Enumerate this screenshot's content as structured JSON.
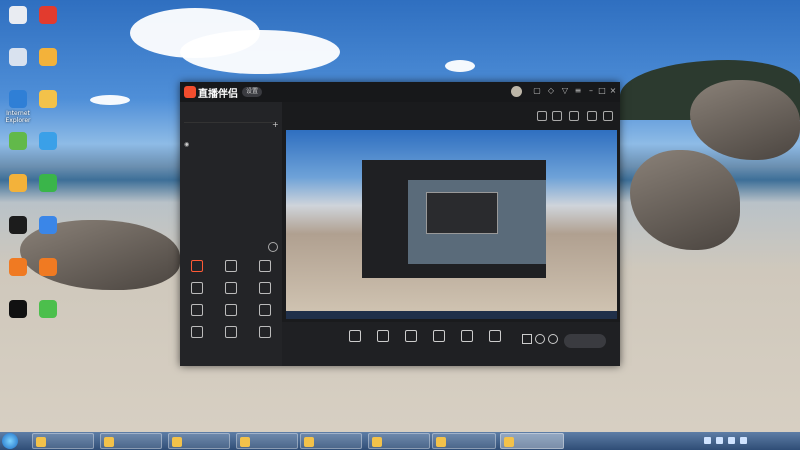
{
  "desktop_icons": [
    {
      "label": "",
      "color": "#e9ecf2"
    },
    {
      "label": "",
      "color": "#e23b2e"
    },
    {
      "label": "",
      "color": "#d9e2ef"
    },
    {
      "label": "",
      "color": "#f3b23a"
    },
    {
      "label": "Internet Explorer",
      "color": "#2f7fd6"
    },
    {
      "label": "",
      "color": "#f3c24a"
    },
    {
      "label": "",
      "color": "#62b94a"
    },
    {
      "label": "",
      "color": "#3aa0e8"
    },
    {
      "label": "",
      "color": "#f3b23a"
    },
    {
      "label": "",
      "color": "#3ab54a"
    },
    {
      "label": "",
      "color": "#1c1c1c"
    },
    {
      "label": "",
      "color": "#3a86e8"
    },
    {
      "label": "",
      "color": "#f07a22"
    },
    {
      "label": "",
      "color": "#f07a22"
    },
    {
      "label": "",
      "color": "#111111"
    },
    {
      "label": "",
      "color": "#4cbf4c"
    }
  ],
  "app": {
    "name": "直播伴侣",
    "badge": "设置",
    "tabs": [
      "",
      "",
      ""
    ],
    "scene": "",
    "tools_title": "",
    "tools": [
      "",
      "",
      "",
      "",
      "",
      "",
      "",
      "",
      "",
      "",
      "",
      ""
    ],
    "sidebar_footer": "",
    "room": {
      "title": "",
      "tag": "",
      "sub": "",
      "count": ""
    },
    "bottom": [
      "",
      "",
      "",
      "",
      "",
      ""
    ],
    "live_button": ""
  },
  "taskbar": {
    "tasks": [
      "",
      "",
      "",
      "",
      "",
      "",
      "",
      "",
      ""
    ],
    "time": "",
    "date": ""
  },
  "colors": {
    "accent": "#ff5a36",
    "window_bg": "#1f2023"
  }
}
